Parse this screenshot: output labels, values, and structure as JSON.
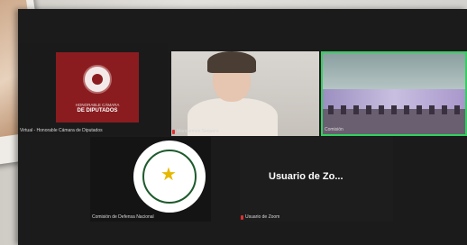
{
  "tiles": {
    "camara": {
      "brand_line1": "HONORABLE CÁMARA",
      "brand_line2": "DE DIPUTADOS",
      "label": "Virtual - Honorable Cámara de Diputados"
    },
    "person": {
      "label": "Maricarmen Sequera"
    },
    "comision": {
      "label": "Comisión"
    },
    "defensa": {
      "label": "Comisión de Defensa Nacional"
    },
    "usuario": {
      "name": "Usuario de Zo...",
      "label": "Usuario de Zoom"
    }
  },
  "colors": {
    "brand_red": "#8a1c1f",
    "active_speaker": "#33d060"
  }
}
